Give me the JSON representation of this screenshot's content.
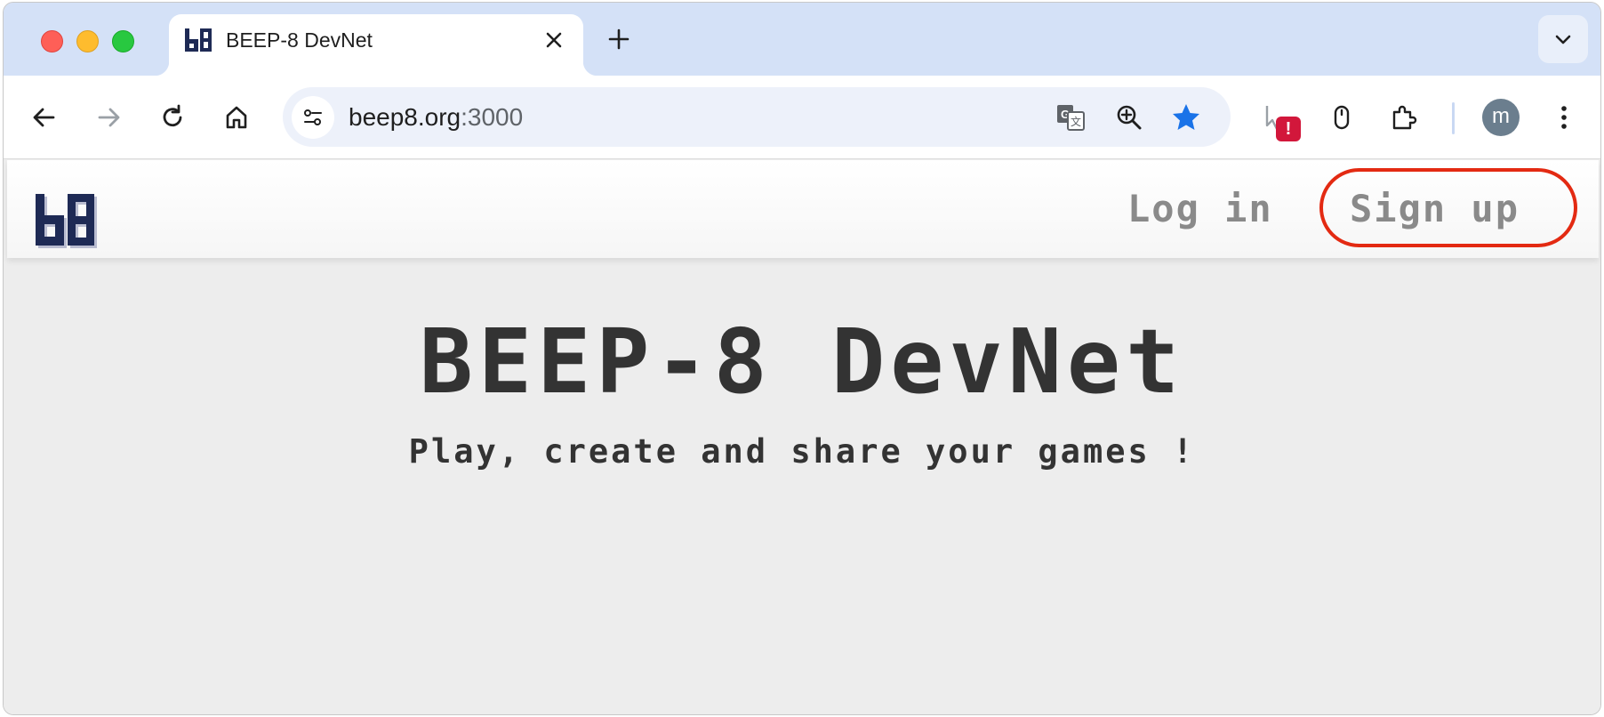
{
  "browser": {
    "tab": {
      "title": "BEEP-8 DevNet",
      "favicon": "beep8-logo-icon"
    },
    "new_tab_icon": "plus-icon",
    "tab_search_icon": "chevron-down-icon",
    "address": {
      "host": "beep8.org",
      "port": ":3000"
    },
    "nav_icons": [
      "back-arrow-icon",
      "forward-arrow-icon",
      "reload-icon",
      "home-icon"
    ],
    "omnibox_icons": [
      "translate-icon",
      "zoom-icon",
      "bookmark-star-icon"
    ],
    "extension_badge": "!",
    "profile_initial": "m",
    "colors": {
      "tabstrip": "#d4e1f7",
      "star": "#1a73e8",
      "badge": "#d2173b"
    }
  },
  "site": {
    "logo_text": "b8",
    "nav": {
      "login": "Log in",
      "signup": "Sign up"
    },
    "hero": {
      "title": "BEEP-8 DevNet",
      "subtitle": "Play, create and share your games !"
    },
    "colors": {
      "text": "#333333",
      "nav": "#8a8a8a",
      "highlight": "#e32a12",
      "logo": "#1e2a55"
    }
  }
}
